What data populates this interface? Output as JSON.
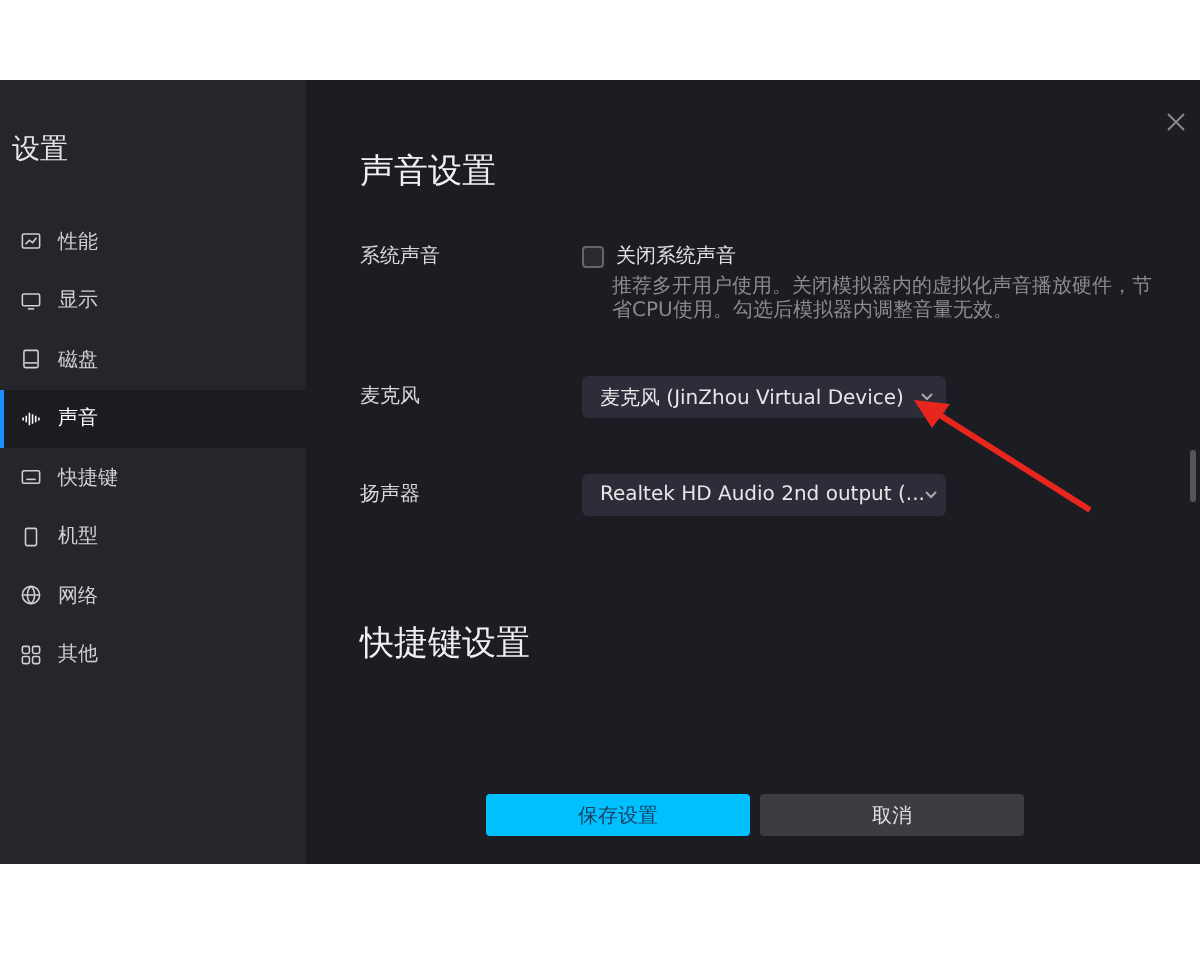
{
  "sidebar": {
    "title": "设置",
    "items": [
      {
        "label": "性能",
        "selected": false
      },
      {
        "label": "显示",
        "selected": false
      },
      {
        "label": "磁盘",
        "selected": false
      },
      {
        "label": "声音",
        "selected": true
      },
      {
        "label": "快捷键",
        "selected": false
      },
      {
        "label": "机型",
        "selected": false
      },
      {
        "label": "网络",
        "selected": false
      },
      {
        "label": "其他",
        "selected": false
      }
    ]
  },
  "sound_settings": {
    "title": "声音设置",
    "system_sound": {
      "label": "系统声音",
      "checkbox_label": "关闭系统声音",
      "checked": false,
      "description": "推荐多开用户使用。关闭模拟器内的虚拟化声音播放硬件，节省CPU使用。勾选后模拟器内调整音量无效。"
    },
    "microphone": {
      "label": "麦克风",
      "value": "麦克风 (JinZhou Virtual Device)"
    },
    "speaker": {
      "label": "扬声器",
      "value": "Realtek HD Audio 2nd output (..."
    }
  },
  "hotkey_settings": {
    "title": "快捷键设置"
  },
  "buttons": {
    "save": "保存设置",
    "cancel": "取消"
  }
}
